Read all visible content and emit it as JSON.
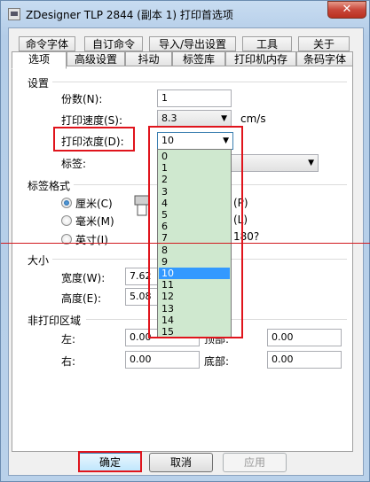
{
  "window": {
    "title": "ZDesigner TLP 2844 (副本 1) 打印首选项",
    "close_glyph": "✕"
  },
  "tabs": {
    "row1": [
      "命令字体",
      "自订命令",
      "导入/导出设置",
      "工具",
      "关于"
    ],
    "row2": [
      "选项",
      "高级设置",
      "抖动",
      "标签库",
      "打印机内存",
      "条码字体"
    ],
    "active": "选项"
  },
  "settings": {
    "group_label": "设置",
    "copies_label": "份数(N):",
    "copies_value": "1",
    "speed_label": "打印速度(S):",
    "speed_value": "8.3",
    "speed_unit": "cm/s",
    "darkness_label": "打印浓度(D):",
    "darkness_value": "10",
    "label_label": "标签:"
  },
  "darkness_options": [
    "0",
    "1",
    "2",
    "3",
    "4",
    "5",
    "6",
    "7",
    "8",
    "9",
    "10",
    "11",
    "12",
    "13",
    "14",
    "15"
  ],
  "darkness_selected_index": 10,
  "label_format": {
    "group_label": "标签格式",
    "unit_cm": "厘米(C)",
    "unit_mm": "毫米(M)",
    "unit_inch": "英寸(I)",
    "selected_unit": "厘米(C)",
    "orientation_portrait_fragment": "(P)",
    "orientation_landscape_fragment": "(L)",
    "rotate_fragment": "180?"
  },
  "size": {
    "group_label": "大小",
    "width_label": "宽度(W):",
    "width_value": "7.62",
    "height_label": "高度(E):",
    "height_value": "5.08"
  },
  "non_print_area": {
    "group_label": "非打印区域",
    "left_label": "左:",
    "left_value": "0.00",
    "right_label": "右:",
    "right_value": "0.00",
    "top_value": "0.00",
    "top_label_fragment": "顶部:",
    "bottom_label": "底部:",
    "bottom_value": "0.00"
  },
  "buttons": {
    "ok": "确定",
    "cancel": "取消",
    "apply": "应用"
  },
  "annotation_color": "#e0141c"
}
